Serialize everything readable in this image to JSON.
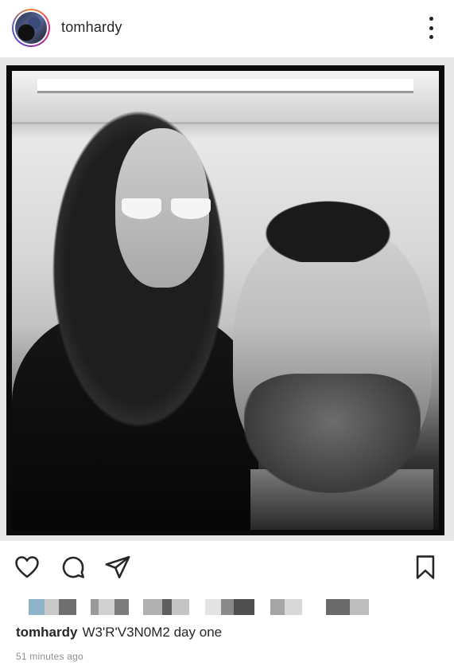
{
  "header": {
    "username": "tomhardy",
    "avatar_icon": "profile-avatar",
    "more_icon": "more-vertical-icon"
  },
  "photo": {
    "description_icon": "post-image"
  },
  "actions": {
    "like_icon": "heart-outline-icon",
    "comment_icon": "comment-bubble-icon",
    "share_icon": "paper-plane-icon",
    "save_icon": "bookmark-icon"
  },
  "likes": {
    "pixelated": true,
    "blocks": [
      "#8fb3c9",
      "#c9c9c9",
      "#6f6f6f",
      "#9a9a9a",
      "#d0d0d0",
      "#7c7c7c",
      "#b0b0b0",
      "#5e5e5e",
      "#c4c4c4",
      "#e3e3e3",
      "#8a8a8a",
      "#4f4f4f",
      "#a5a5a5",
      "#d8d8d8",
      "#6a6a6a",
      "#bdbdbd"
    ]
  },
  "caption": {
    "username": "tomhardy",
    "text": "W3'R'V3N0M2 day one"
  },
  "timestamp": "51 minutes ago",
  "colors": {
    "text": "#262626",
    "muted": "#8e8e8e",
    "background": "#ffffff"
  }
}
